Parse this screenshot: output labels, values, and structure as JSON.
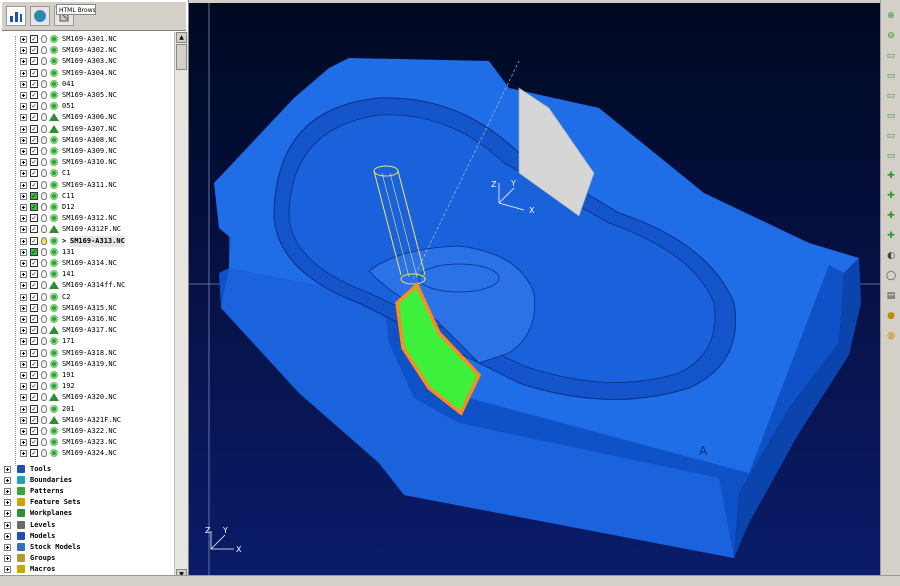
{
  "browser": {
    "tab_label": "HTML Browser",
    "current_prefix": ">"
  },
  "toolpaths": [
    {
      "label": "SM169-A301.NC",
      "icon": "gear",
      "checked": true,
      "lit": false
    },
    {
      "label": "SM169-A302.NC",
      "icon": "gear",
      "checked": true,
      "lit": false
    },
    {
      "label": "SM169-A303.NC",
      "icon": "gear",
      "checked": true,
      "lit": false
    },
    {
      "label": "SM169-A304.NC",
      "icon": "gear",
      "checked": true,
      "lit": false
    },
    {
      "label": "041",
      "icon": "gear",
      "checked": true,
      "lit": false
    },
    {
      "label": "SM169-A305.NC",
      "icon": "gear",
      "checked": true,
      "lit": false
    },
    {
      "label": "051",
      "icon": "gear",
      "checked": true,
      "lit": false
    },
    {
      "label": "SM169-A306.NC",
      "icon": "tri",
      "checked": true,
      "lit": false
    },
    {
      "label": "SM169-A307.NC",
      "icon": "tri",
      "checked": true,
      "lit": false
    },
    {
      "label": "SM169-A308.NC",
      "icon": "gear",
      "checked": true,
      "lit": false
    },
    {
      "label": "SM169-A309.NC",
      "icon": "gear",
      "checked": true,
      "lit": false
    },
    {
      "label": "SM169-A310.NC",
      "icon": "gear",
      "checked": true,
      "lit": false
    },
    {
      "label": "C1",
      "icon": "gear",
      "checked": true,
      "lit": false
    },
    {
      "label": "SM169-A311.NC",
      "icon": "gear",
      "checked": true,
      "lit": false
    },
    {
      "label": "C11",
      "icon": "gear",
      "checked": true,
      "lit": false,
      "green": true
    },
    {
      "label": "D12",
      "icon": "gear",
      "checked": true,
      "lit": false,
      "green": true
    },
    {
      "label": "SM169-A312.NC",
      "icon": "gear",
      "checked": true,
      "lit": false
    },
    {
      "label": "SM169-A312F.NC",
      "icon": "tri",
      "checked": true,
      "lit": false
    },
    {
      "label": "SM169-A313.NC",
      "icon": "gear",
      "checked": true,
      "lit": true,
      "current": true
    },
    {
      "label": "131",
      "icon": "gear",
      "checked": true,
      "lit": false,
      "green": true
    },
    {
      "label": "SM169-A314.NC",
      "icon": "gear",
      "checked": true,
      "lit": false
    },
    {
      "label": "141",
      "icon": "gear",
      "checked": true,
      "lit": false
    },
    {
      "label": "SM169-A314ff.NC",
      "icon": "tri",
      "checked": true,
      "lit": false
    },
    {
      "label": "C2",
      "icon": "gear",
      "checked": true,
      "lit": false
    },
    {
      "label": "SM169-A315.NC",
      "icon": "gear",
      "checked": true,
      "lit": false
    },
    {
      "label": "SM169-A316.NC",
      "icon": "gear",
      "checked": true,
      "lit": false
    },
    {
      "label": "SM169-A317.NC",
      "icon": "tri",
      "checked": true,
      "lit": false
    },
    {
      "label": "171",
      "icon": "gear",
      "checked": true,
      "lit": false
    },
    {
      "label": "SM169-A318.NC",
      "icon": "gear",
      "checked": true,
      "lit": false
    },
    {
      "label": "SM169-A319.NC",
      "icon": "gear",
      "checked": true,
      "lit": false
    },
    {
      "label": "191",
      "icon": "gear",
      "checked": true,
      "lit": false
    },
    {
      "label": "192",
      "icon": "gear",
      "checked": true,
      "lit": false
    },
    {
      "label": "SM169-A320.NC",
      "icon": "tri",
      "checked": true,
      "lit": false
    },
    {
      "label": "201",
      "icon": "gear",
      "checked": true,
      "lit": false
    },
    {
      "label": "SM169-A321F.NC",
      "icon": "tri",
      "checked": true,
      "lit": false
    },
    {
      "label": "SM169-A322.NC",
      "icon": "gear",
      "checked": true,
      "lit": false
    },
    {
      "label": "SM169-A323.NC",
      "icon": "gear",
      "checked": true,
      "lit": false
    },
    {
      "label": "SM169-A324.NC",
      "icon": "gear",
      "checked": true,
      "lit": false
    }
  ],
  "groups": [
    {
      "label": "Tools",
      "bold": true
    },
    {
      "label": "Boundaries"
    },
    {
      "label": "Patterns"
    },
    {
      "label": "Feature Sets"
    },
    {
      "label": "Workplanes"
    },
    {
      "label": "Levels"
    },
    {
      "label": "Models"
    },
    {
      "label": "Stock Models"
    },
    {
      "label": "Groups"
    },
    {
      "label": "Macros"
    }
  ],
  "viewport": {
    "main_axis": {
      "z": "Z",
      "y": "Y",
      "x": "X"
    },
    "corner_axis": {
      "z": "Z",
      "y": "Y",
      "x": "X"
    },
    "corner_letter": "A"
  },
  "colors": {
    "part_blue": "#1f6ee8",
    "part_dark": "#0c3f9e",
    "toolpath_green": "#3cf03c",
    "toolpath_orange": "#ff8a1e",
    "tool_yellow": "#f2e65a",
    "fixture_gray": "#d6d6d6"
  },
  "toolbar_icons": [
    "zoom-in-icon",
    "zoom-out-icon",
    "view-top-icon",
    "view-bottom-icon",
    "view-left-icon",
    "view-right-icon",
    "view-front-icon",
    "view-back-icon",
    "iso-1-icon",
    "iso-2-icon",
    "iso-3-icon",
    "iso-4-icon",
    "shade-icon",
    "wire-icon",
    "stock-icon",
    "light-icon",
    "globe-icon"
  ]
}
